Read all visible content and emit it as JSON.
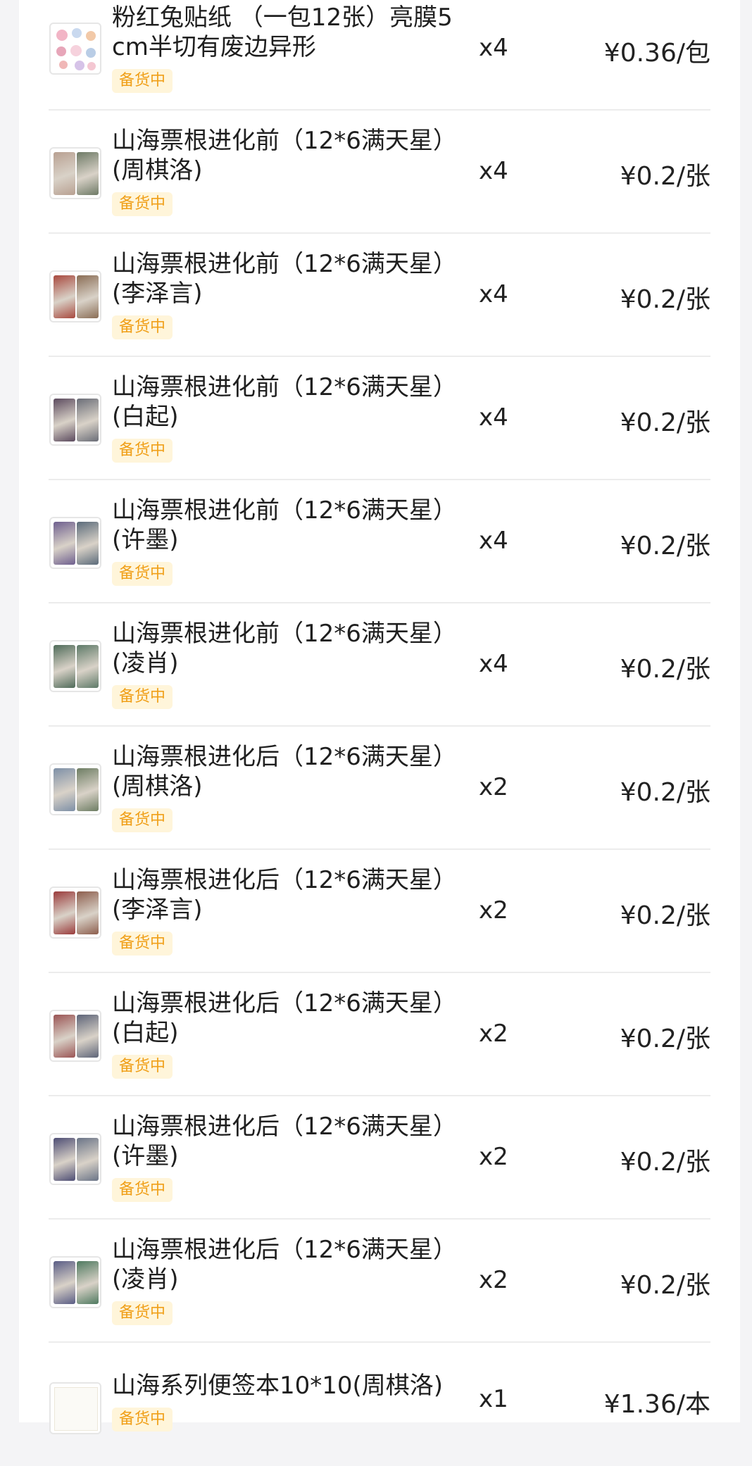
{
  "items": [
    {
      "title": "粉红兔贴纸 （一包12张）亮膜5cm半切有废边异形",
      "status": "备货中",
      "qty": "x4",
      "price": "¥0.36/包",
      "thumb": "stickers"
    },
    {
      "title": "山海票根进化前（12*6满天星）(周棋洛)",
      "status": "备货中",
      "qty": "x4",
      "price": "¥0.2/张",
      "thumb": "ticket",
      "colors": [
        "#b8a091",
        "#6e7a66"
      ]
    },
    {
      "title": "山海票根进化前（12*6满天星）(李泽言)",
      "status": "备货中",
      "qty": "x4",
      "price": "¥0.2/张",
      "thumb": "ticket",
      "colors": [
        "#a8493e",
        "#8a6d55"
      ]
    },
    {
      "title": "山海票根进化前（12*6满天星）(白起)",
      "status": "备货中",
      "qty": "x4",
      "price": "¥0.2/张",
      "thumb": "ticket",
      "colors": [
        "#5b4a5e",
        "#6a6d77"
      ]
    },
    {
      "title": "山海票根进化前（12*6满天星）(许墨)",
      "status": "备货中",
      "qty": "x4",
      "price": "¥0.2/张",
      "thumb": "ticket",
      "colors": [
        "#6e5f8e",
        "#5b6b7a"
      ]
    },
    {
      "title": "山海票根进化前（12*6满天星）(凌肖)",
      "status": "备货中",
      "qty": "x4",
      "price": "¥0.2/张",
      "thumb": "ticket",
      "colors": [
        "#4f6b59",
        "#5e7a68"
      ]
    },
    {
      "title": "山海票根进化后（12*6满天星）(周棋洛)",
      "status": "备货中",
      "qty": "x2",
      "price": "¥0.2/张",
      "thumb": "ticket",
      "colors": [
        "#7d8fa6",
        "#6d7d63"
      ]
    },
    {
      "title": "山海票根进化后（12*6满天星）(李泽言)",
      "status": "备货中",
      "qty": "x2",
      "price": "¥0.2/张",
      "thumb": "ticket",
      "colors": [
        "#9a3b3b",
        "#8d5e4d"
      ]
    },
    {
      "title": "山海票根进化后（12*6满天星）(白起)",
      "status": "备货中",
      "qty": "x2",
      "price": "¥0.2/张",
      "thumb": "ticket",
      "colors": [
        "#9a5454",
        "#5d6478"
      ]
    },
    {
      "title": "山海票根进化后（12*6满天星）(许墨)",
      "status": "备货中",
      "qty": "x2",
      "price": "¥0.2/张",
      "thumb": "ticket",
      "colors": [
        "#4d4d74",
        "#6a7487"
      ]
    },
    {
      "title": "山海票根进化后（12*6满天星）(凌肖)",
      "status": "备货中",
      "qty": "x2",
      "price": "¥0.2/张",
      "thumb": "ticket",
      "colors": [
        "#5a5d85",
        "#4f7a60"
      ]
    },
    {
      "title": "山海系列便签本10*10(周棋洛)",
      "status": "备货中",
      "qty": "x1",
      "price": "¥1.36/本",
      "thumb": "notebook"
    }
  ]
}
